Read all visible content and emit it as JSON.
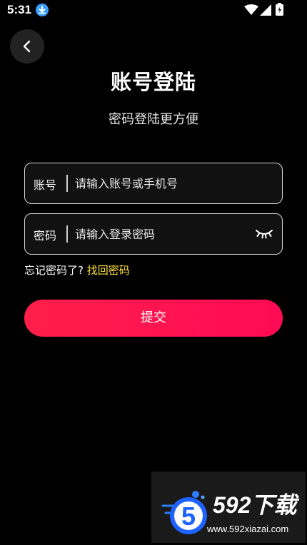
{
  "status_bar": {
    "time": "5:31",
    "icons": [
      "download-icon",
      "wifi-icon",
      "signal-icon",
      "battery-icon"
    ]
  },
  "header": {
    "back_icon": "chevron-left-icon",
    "title": "账号登陆",
    "subtitle": "密码登陆更方便"
  },
  "form": {
    "account": {
      "label": "账号",
      "value": "",
      "placeholder": "请输入账号或手机号"
    },
    "password": {
      "label": "密码",
      "value": "",
      "placeholder": "请输入登录密码",
      "toggle_icon": "eye-closed-icon"
    },
    "forgot_text": "忘记密码了?",
    "forgot_link": "找回密码",
    "submit_label": "提交"
  },
  "watermark": {
    "brand": "592下载",
    "url": "www.592xiazai.com"
  },
  "colors": {
    "background": "#000000",
    "accent": "#ff1550",
    "link": "#ffe033",
    "field_border": "#d9d9d9"
  }
}
